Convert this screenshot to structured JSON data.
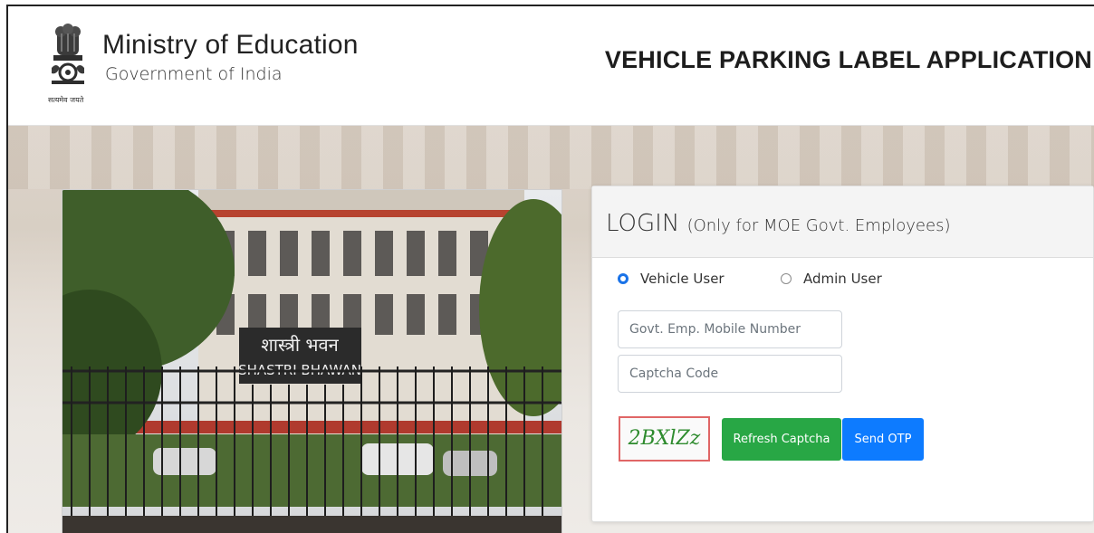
{
  "header": {
    "brand_title": "Ministry of Education",
    "brand_subtitle": "Government of India",
    "emblem_motto": "सत्यमेव जयते",
    "app_title": "VEHICLE PARKING LABEL APPLICATION"
  },
  "photo": {
    "sign_hindi": "शास्त्री भवन",
    "sign_english": "SHASTRI BHAWAN"
  },
  "login": {
    "title": "LOGIN",
    "title_note": "(Only for MOE Govt. Employees)",
    "radio_vehicle_label": "Vehicle User",
    "radio_admin_label": "Admin User",
    "selected_role": "Vehicle User",
    "mobile_placeholder": "Govt. Emp. Mobile Number",
    "captcha_placeholder": "Captcha Code",
    "captcha_text": "2BXlZz",
    "refresh_label": "Refresh Captcha",
    "send_otp_label": "Send OTP"
  },
  "colors": {
    "refresh_button": "#28a745",
    "send_otp_button": "#0d7bff",
    "captcha_border": "#e06666",
    "radio_selected": "#1a73e8"
  },
  "icons": {
    "emblem": "national-emblem-icon"
  }
}
